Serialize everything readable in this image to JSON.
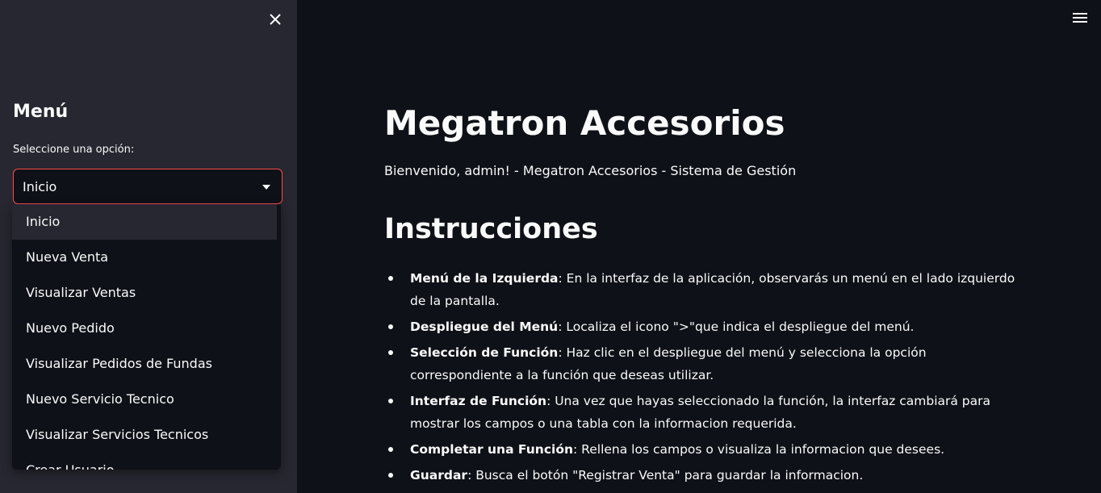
{
  "sidebar": {
    "menu_title": "Menú",
    "select_label": "Seleccione una opción:",
    "selected_value": "Inicio",
    "options": [
      "Inicio",
      "Nueva Venta",
      "Visualizar Ventas",
      "Nuevo Pedido",
      "Visualizar Pedidos de Fundas",
      "Nuevo Servicio Tecnico",
      "Visualizar Servicios Tecnicos",
      "Crear Usuario"
    ]
  },
  "main": {
    "title": "Megatron Accesorios",
    "welcome": "Bienvenido, admin! - Megatron Accesorios - Sistema de Gestión",
    "section_title": "Instrucciones",
    "instructions": [
      {
        "bold": "Menú de la Izquierda",
        "text": ": En la interfaz de la aplicación, observarás un menú en el lado izquierdo de la pantalla."
      },
      {
        "bold": "Despliegue del Menú",
        "text": ": Localiza el icono \">\"que indica el despliegue del menú."
      },
      {
        "bold": "Selección de Función",
        "text": ": Haz clic en el despliegue del menú y selecciona la opción correspondiente a la función que deseas utilizar."
      },
      {
        "bold": "Interfaz de Función",
        "text": ": Una vez que hayas seleccionado la función, la interfaz cambiará para mostrar los campos o una tabla con la informacion requerida."
      },
      {
        "bold": "Completar una Función",
        "text": ": Rellena los campos o visualiza la informacion que desees."
      },
      {
        "bold": "Guardar",
        "text": ": Busca el botón \"Registrar Venta\" para guardar la informacion."
      }
    ]
  },
  "icons": {
    "close": "close-icon",
    "menu": "hamburger-menu-icon",
    "caret": "chevron-down-icon"
  },
  "colors": {
    "background": "#0e1117",
    "sidebar": "#262730",
    "accent": "#ff4b4b",
    "text": "#fafafa"
  }
}
